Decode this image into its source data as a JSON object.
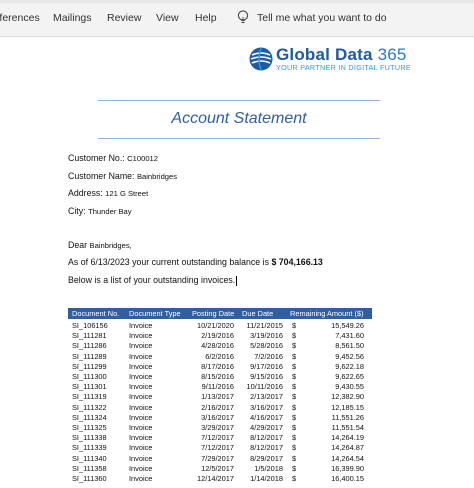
{
  "ribbon": {
    "tabs": [
      "References",
      "Mailings",
      "Review",
      "View",
      "Help"
    ],
    "tell_me": "Tell me what you want to do"
  },
  "logo": {
    "name": "Global Data",
    "number": "365",
    "tagline": "YOUR PARTNER IN DIGITAL FUTURE"
  },
  "doc": {
    "title": "Account Statement",
    "customer_no_label": "Customer No.:",
    "customer_no": "C100012",
    "customer_name_label": "Customer Name:",
    "customer_name": "Bainbridges",
    "address_label": "Address:",
    "address": "121 G Street",
    "city_label": "City:",
    "city": "Thunder Bay",
    "greeting": "Dear",
    "greeting_name": "Bainbridges,",
    "balance_text": "As of 6/13/2023 your current outstanding balance is",
    "balance_value": "$ 704,166.13",
    "list_text": "Below is a list of your outstanding invoices."
  },
  "table": {
    "headers": [
      "Document No.",
      "Document Type",
      "Posting Date",
      "Due Date",
      "Remaining Amount ($)"
    ],
    "rows": [
      [
        "SI_106156",
        "Invoice",
        "10/21/2020",
        "11/21/2015",
        "$",
        "15,549.26"
      ],
      [
        "SI_111281",
        "Invoice",
        "2/19/2016",
        "3/19/2016",
        "$",
        "7,431.60"
      ],
      [
        "SI_111286",
        "Invoice",
        "4/28/2016",
        "5/28/2016",
        "$",
        "8,561.50"
      ],
      [
        "SI_111289",
        "Invoice",
        "6/2/2016",
        "7/2/2016",
        "$",
        "9,452.56"
      ],
      [
        "SI_111299",
        "Invoice",
        "8/17/2016",
        "9/17/2016",
        "$",
        "9,622.18"
      ],
      [
        "SI_111300",
        "Invoice",
        "8/15/2016",
        "9/15/2016",
        "$",
        "9,622.65"
      ],
      [
        "SI_111301",
        "Invoice",
        "9/11/2016",
        "10/11/2016",
        "$",
        "9,430.55"
      ],
      [
        "SI_111319",
        "Invoice",
        "1/13/2017",
        "2/13/2017",
        "$",
        "12,382.90"
      ],
      [
        "SI_111322",
        "Invoice",
        "2/16/2017",
        "3/16/2017",
        "$",
        "12,185.15"
      ],
      [
        "SI_111324",
        "Invoice",
        "3/16/2017",
        "4/16/2017",
        "$",
        "11,551.26"
      ],
      [
        "SI_111325",
        "Invoice",
        "3/29/2017",
        "4/29/2017",
        "$",
        "11,551.54"
      ],
      [
        "SI_111338",
        "Invoice",
        "7/12/2017",
        "8/12/2017",
        "$",
        "14,264.19"
      ],
      [
        "SI_111339",
        "Invoice",
        "7/12/2017",
        "8/12/2017",
        "$",
        "14,264.87"
      ],
      [
        "SI_111340",
        "Invoice",
        "7/29/2017",
        "8/29/2017",
        "$",
        "14,264.54"
      ],
      [
        "SI_111358",
        "Invoice",
        "12/5/2017",
        "1/5/2018",
        "$",
        "16,399.90"
      ],
      [
        "SI_111360",
        "Invoice",
        "12/14/2017",
        "1/14/2018",
        "$",
        "16,400.15"
      ]
    ]
  },
  "colors": {
    "header_bg": "#2f5f9e",
    "title": "#2e5f9e",
    "logo": "#1f5aa6"
  }
}
